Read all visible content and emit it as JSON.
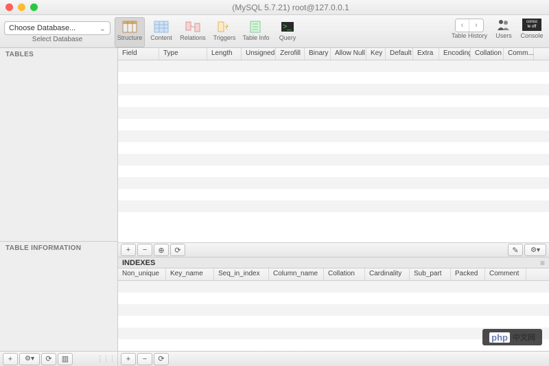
{
  "window": {
    "title": "(MySQL 5.7.21) root@127.0.0.1"
  },
  "dbChooser": {
    "placeholder": "Choose Database...",
    "label": "Select Database"
  },
  "tabs": {
    "structure": "Structure",
    "content": "Content",
    "relations": "Relations",
    "triggers": "Triggers",
    "tableinfo": "Table Info",
    "query": "Query"
  },
  "rightTools": {
    "history": "Table History",
    "users": "Users",
    "console": "Console",
    "consoleBadge": "conso\nle off"
  },
  "sidebar": {
    "tables": "TABLES",
    "tableInfo": "TABLE INFORMATION"
  },
  "fields": {
    "columns": [
      "Field",
      "Type",
      "Length",
      "Unsigned",
      "Zerofill",
      "Binary",
      "Allow Null",
      "Key",
      "Default",
      "Extra",
      "Encoding",
      "Collation",
      "Comm..."
    ],
    "widths": [
      60,
      70,
      50,
      50,
      42,
      38,
      52,
      28,
      40,
      38,
      46,
      48,
      44
    ]
  },
  "indexes": {
    "label": "INDEXES",
    "columns": [
      "Non_unique",
      "Key_name",
      "Seq_in_index",
      "Column_name",
      "Collation",
      "Cardinality",
      "Sub_part",
      "Packed",
      "Comment"
    ],
    "widths": [
      70,
      70,
      80,
      80,
      60,
      65,
      60,
      50,
      60
    ]
  },
  "buttons": {
    "plus": "+",
    "minus": "−",
    "dup": "⊕",
    "refresh": "⟳",
    "gear": "⚙",
    "pencil": "✎",
    "cols": "▥",
    "gearDrop": "⚙▾"
  },
  "watermark": {
    "prefix": "php",
    "text": "中文网"
  }
}
